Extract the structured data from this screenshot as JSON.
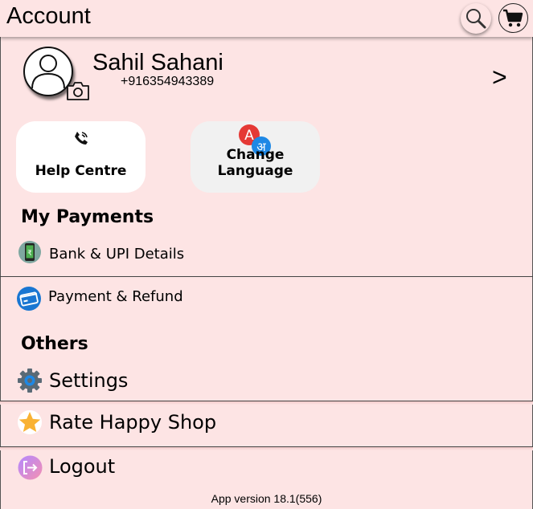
{
  "header": {
    "title": "Account"
  },
  "profile": {
    "name": "Sahil Sahani",
    "phone": "+916354943389",
    "arrow": ">"
  },
  "cards": {
    "help": "Help Centre",
    "language": "Change Language",
    "language_badge_a": "A",
    "language_badge_b": "अ"
  },
  "payments": {
    "heading": "My Payments",
    "items": [
      {
        "label": "Bank & UPI Details",
        "icon": "phone-upi-icon"
      },
      {
        "label": "Payment & Refund",
        "icon": "credit-card-icon"
      }
    ]
  },
  "others": {
    "heading": "Others",
    "items": [
      {
        "label": "Settings",
        "icon": "gear-icon"
      },
      {
        "label": "Rate Happy Shop",
        "icon": "star-icon"
      },
      {
        "label": "Logout",
        "icon": "logout-icon"
      }
    ]
  },
  "footer": {
    "version": "App version 18.1(556)"
  },
  "colors": {
    "background": "#fde4e4",
    "card": "#ffffff",
    "badge_red": "#e53935",
    "badge_blue": "#1e88e5"
  }
}
